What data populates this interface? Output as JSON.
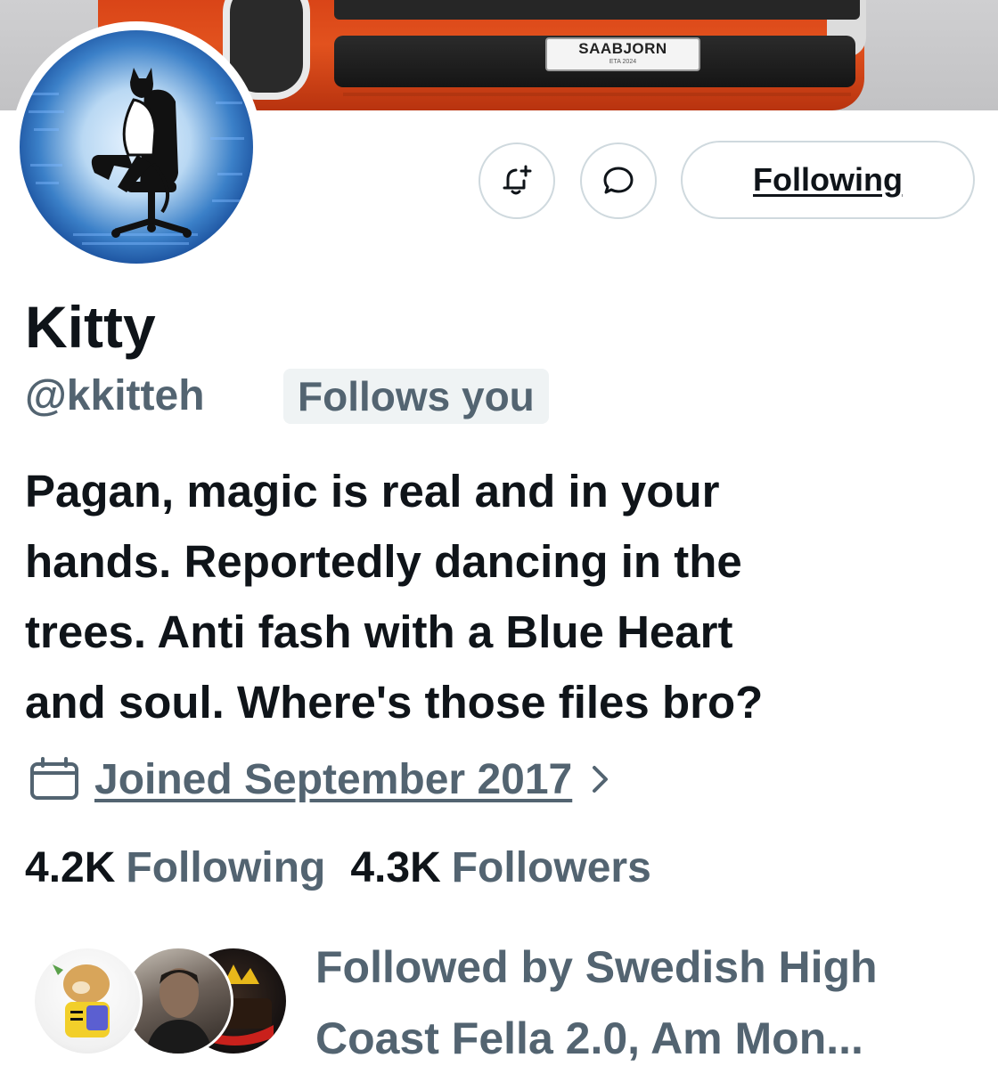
{
  "banner": {
    "plate_text": "SAABJORN",
    "plate_sub": "ETA 2024"
  },
  "profile": {
    "display_name": "Kitty",
    "handle": "@kkitteh",
    "follows_you_badge": "Follows you",
    "bio_lines": [
      "Pagan, magic is real and in your",
      "hands. Reportedly dancing in the",
      "trees. Anti fash with a Blue Heart",
      "and soul. Where's those files bro?"
    ],
    "joined": "Joined September 2017"
  },
  "actions": {
    "notify_icon": "bell-plus-icon",
    "message_icon": "message-bubble-icon",
    "following_label": "Following"
  },
  "stats": {
    "following_count": "4.2K",
    "following_label": "Following",
    "followers_count": "4.3K",
    "followers_label": "Followers"
  },
  "followed_by": {
    "lines": [
      "Followed by Swedish High",
      "Coast Fella 2.0, Am Mon..."
    ]
  },
  "colors": {
    "text_primary": "#0f1419",
    "text_secondary": "#536471",
    "border": "#cfd9de",
    "badge_bg": "#eff3f4"
  }
}
